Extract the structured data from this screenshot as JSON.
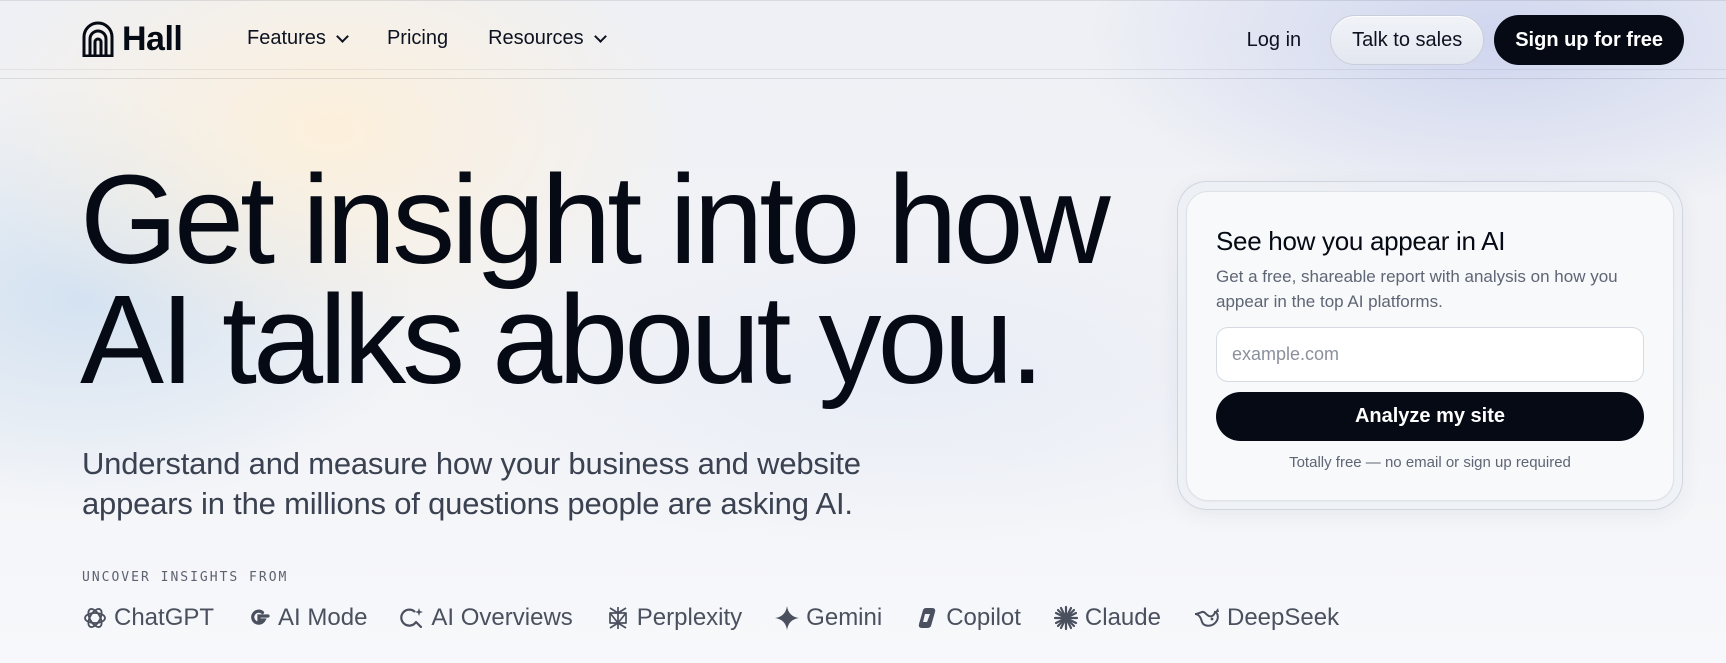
{
  "nav": {
    "logo_text": "Hall",
    "links": [
      {
        "label": "Features",
        "has_dropdown": true
      },
      {
        "label": "Pricing",
        "has_dropdown": false
      },
      {
        "label": "Resources",
        "has_dropdown": true
      }
    ],
    "login_label": "Log in",
    "sales_label": "Talk to sales",
    "signup_label": "Sign up for free"
  },
  "hero": {
    "title_line1": "Get insight into how",
    "title_line2": "AI talks about you.",
    "subtitle_line1": "Understand and measure how your business and website",
    "subtitle_line2": "appears in the millions of questions people are asking AI.",
    "uncover_label": "UNCOVER INSIGHTS FROM",
    "platforms": [
      {
        "name": "ChatGPT",
        "icon": "openai-icon"
      },
      {
        "name": "AI Mode",
        "icon": "google-g-icon"
      },
      {
        "name": "AI Overviews",
        "icon": "ai-overviews-icon"
      },
      {
        "name": "Perplexity",
        "icon": "perplexity-icon"
      },
      {
        "name": "Gemini",
        "icon": "gemini-sparkle-icon"
      },
      {
        "name": "Copilot",
        "icon": "copilot-icon"
      },
      {
        "name": "Claude",
        "icon": "claude-starburst-icon"
      },
      {
        "name": "DeepSeek",
        "icon": "deepseek-whale-icon"
      }
    ]
  },
  "card": {
    "title": "See how you appear in AI",
    "description": "Get a free, shareable report with analysis on how you appear in the top AI platforms.",
    "input_placeholder": "example.com",
    "input_value": "",
    "button_label": "Analyze my site",
    "note": "Totally free — no email or sign up required"
  },
  "colors": {
    "primary_dark": "#050a14",
    "body_text": "#3a4150",
    "muted_text": "#5e6574"
  }
}
